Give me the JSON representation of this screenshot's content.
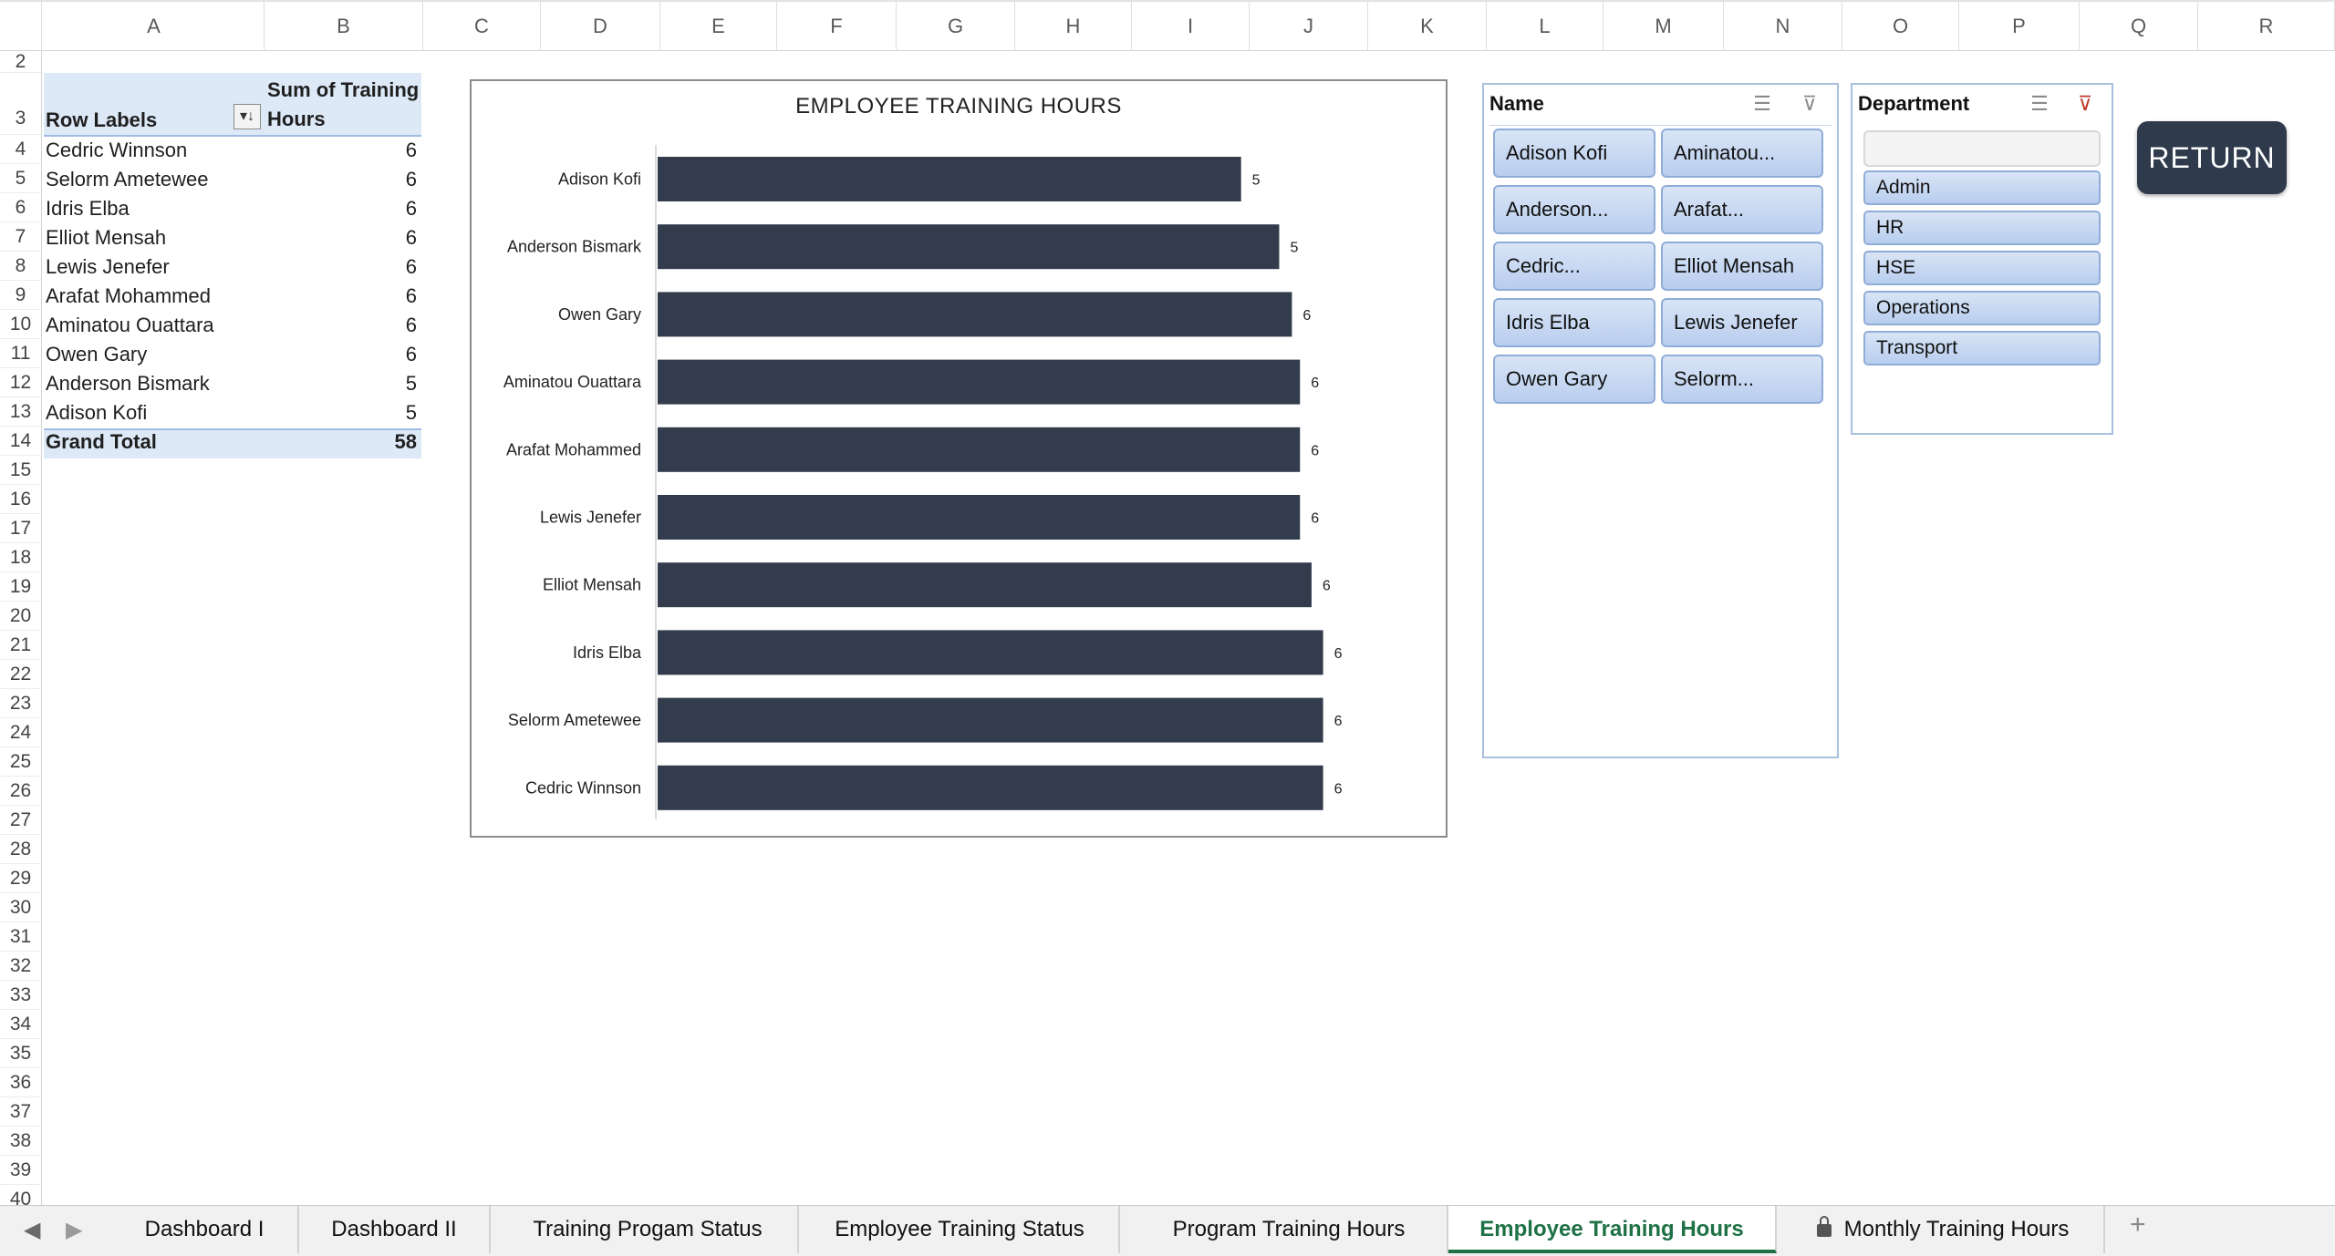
{
  "columns": [
    "A",
    "B",
    "C",
    "D",
    "E",
    "F",
    "G",
    "H",
    "I",
    "J",
    "K",
    "L",
    "M",
    "N",
    "O",
    "P",
    "Q",
    "R"
  ],
  "rows": [
    "2",
    "3",
    "4",
    "5",
    "6",
    "7",
    "8",
    "9",
    "10",
    "11",
    "12",
    "13",
    "14",
    "15",
    "16",
    "17",
    "18",
    "19",
    "20",
    "21",
    "22",
    "23",
    "24",
    "25",
    "26",
    "27",
    "28",
    "29",
    "30",
    "31",
    "32",
    "33",
    "34",
    "35",
    "36",
    "37",
    "38",
    "39",
    "40"
  ],
  "pivot": {
    "row_labels_header": "Row Labels",
    "value_header_line1": "Sum of Training",
    "value_header_line2": "Hours",
    "rows": [
      {
        "name": "Cedric Winnson",
        "value": "6"
      },
      {
        "name": "Selorm Ametewee",
        "value": "6"
      },
      {
        "name": "Idris Elba",
        "value": "6"
      },
      {
        "name": "Elliot Mensah",
        "value": "6"
      },
      {
        "name": "Lewis Jenefer",
        "value": "6"
      },
      {
        "name": "Arafat Mohammed",
        "value": "6"
      },
      {
        "name": "Aminatou Ouattara",
        "value": "6"
      },
      {
        "name": "Owen Gary",
        "value": "6"
      },
      {
        "name": "Anderson Bismark",
        "value": "5"
      },
      {
        "name": "Adison Kofi",
        "value": "5"
      }
    ],
    "total_label": "Grand Total",
    "total_value": "58"
  },
  "chart_data": {
    "type": "bar",
    "orientation": "horizontal",
    "title": "EMPLOYEE TRAINING HOURS",
    "categories": [
      "Adison Kofi",
      "Anderson Bismark",
      "Owen Gary",
      "Aminatou Ouattara",
      "Arafat Mohammed",
      "Lewis Jenefer",
      "Elliot Mensah",
      "Idris Elba",
      "Selorm Ametewee",
      "Cedric Winnson"
    ],
    "values": [
      5.05,
      5.38,
      5.49,
      5.56,
      5.56,
      5.56,
      5.66,
      5.76,
      5.76,
      5.76
    ],
    "data_labels": [
      "5",
      "5",
      "6",
      "6",
      "6",
      "6",
      "6",
      "6",
      "6",
      "6"
    ],
    "xlim": [
      0,
      6
    ],
    "bar_color": "#333c4c",
    "grid": false,
    "legend": "none"
  },
  "name_slicer": {
    "title": "Name",
    "items": [
      "Adison Kofi",
      "Aminatou...",
      "Anderson...",
      "Arafat...",
      "Cedric...",
      "Elliot Mensah",
      "Idris Elba",
      "Lewis Jenefer",
      "Owen Gary",
      "Selorm..."
    ]
  },
  "dept_slicer": {
    "title": "Department",
    "items": [
      "Admin",
      "HR",
      "HSE",
      "Operations",
      "Transport"
    ]
  },
  "return_label": "RETURN",
  "tabs": [
    {
      "label": "Dashboard I",
      "active": false
    },
    {
      "label": "Dashboard II",
      "active": false
    },
    {
      "label": "Training Progam Status",
      "active": false
    },
    {
      "label": "Employee Training Status",
      "active": false
    },
    {
      "label": "Program Training Hours",
      "active": false
    },
    {
      "label": "Employee Training Hours",
      "active": true
    },
    {
      "label": "Monthly Training Hours",
      "active": false
    }
  ],
  "add_tab_label": "+",
  "colors": {
    "accent": "#1e7145",
    "slicer_fill": "#c9daf2",
    "pivot_header": "#dde9f7"
  }
}
